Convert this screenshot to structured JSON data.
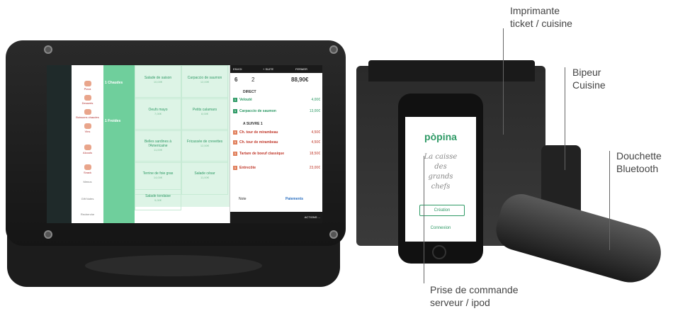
{
  "labels": {
    "printer_l1": "Imprimante",
    "printer_l2": "ticket / cuisine",
    "buzzer_l1": "Bipeur",
    "buzzer_l2": "Cuisine",
    "scanner_l1": "Douchette",
    "scanner_l2": "Bluetooth",
    "phone_l1": "Prise de commande",
    "phone_l2": "serveur / ipod"
  },
  "tablet_app": {
    "categories": [
      "Pizza",
      "Desserts",
      "Boissons chaudes",
      "Vins",
      "Alcools",
      "Snack",
      "Menus",
      "Gift Notes",
      "Recherche"
    ],
    "subcategories": [
      "Chaudes",
      "Froides"
    ],
    "grid": [
      {
        "name": "Salade de saison",
        "price": "10,00€"
      },
      {
        "name": "Carpaccio de saumon",
        "price": "12,00€"
      },
      {
        "name": "Oeufs mayo",
        "price": "7,00€"
      },
      {
        "name": "Petits calamars",
        "price": "8,00€"
      },
      {
        "name": "Belles sardines à l'Americaine",
        "price": "11,00€"
      },
      {
        "name": "Fricassée de crevettes",
        "price": "12,50€"
      },
      {
        "name": "Terrine de foie gras",
        "price": "14,00€"
      },
      {
        "name": "Salade césar",
        "price": "11,00€"
      },
      {
        "name": "Salade tondaise",
        "price": "9,00€"
      }
    ],
    "order": {
      "header": {
        "envoi": "ENVOI",
        "suite": "+ SUITE",
        "fermer": "FERMER"
      },
      "table": "6",
      "covers": "2",
      "total": "88,90€",
      "direct_label": "DIRECT",
      "follow_label": "A SUIVRE 1",
      "direct_items": [
        {
          "qty": "1",
          "name": "Velouté",
          "price": "4,00€"
        },
        {
          "qty": "1",
          "name": "Carpaccio de saumon",
          "price": "13,00€"
        }
      ],
      "follow_items": [
        {
          "qty": "1",
          "name": "Ch. tour de mirambeau",
          "price": "4,50€"
        },
        {
          "qty": "1",
          "name": "Ch. tour de mirambeau",
          "price": "4,50€"
        },
        {
          "qty": "1",
          "name": "Tartare de boeuf classique",
          "price": "18,50€"
        },
        {
          "qty": "1",
          "name": "Entrecôte",
          "price": "23,00€"
        }
      ],
      "note": "Note",
      "paiements": "Paiements",
      "actions": "ACTIONS ..."
    }
  },
  "phone_app": {
    "brand": "pòpina",
    "tagline_l1": "La caisse",
    "tagline_l2": "des",
    "tagline_l3": "grands",
    "tagline_l4": "chefs",
    "creation": "Création",
    "connexion": "Connexion"
  }
}
